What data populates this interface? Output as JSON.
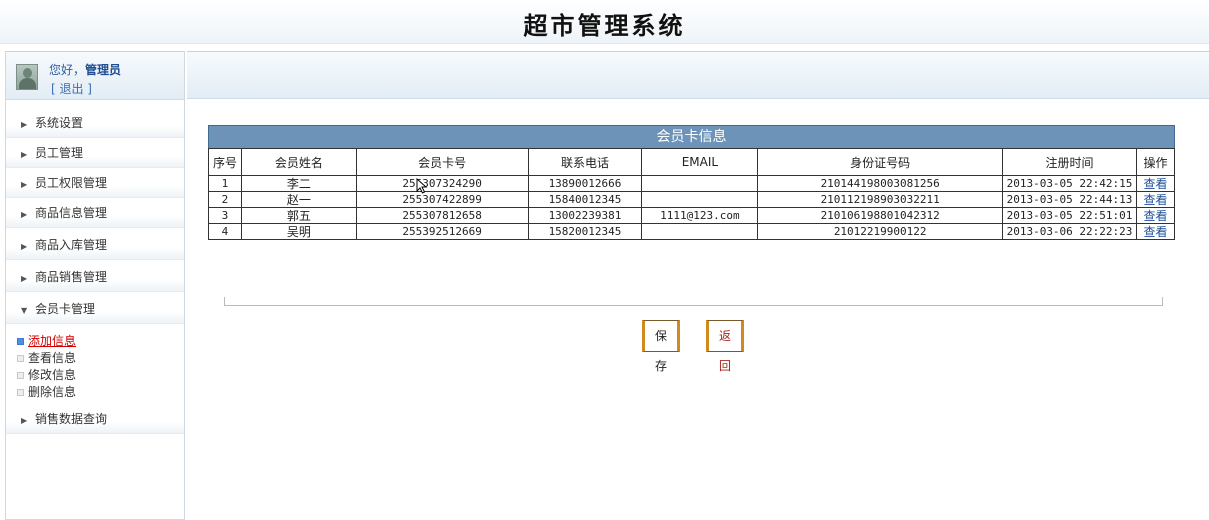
{
  "header": {
    "title": "超市管理系统"
  },
  "user": {
    "greeting_prefix": "您好，",
    "name": "管理员",
    "logout": "[ 退出 ]"
  },
  "sidebar": {
    "items": [
      {
        "label": "系统设置",
        "expanded": false
      },
      {
        "label": "员工管理",
        "expanded": false
      },
      {
        "label": "员工权限管理",
        "expanded": false
      },
      {
        "label": "商品信息管理",
        "expanded": false
      },
      {
        "label": "商品入库管理",
        "expanded": false
      },
      {
        "label": "商品销售管理",
        "expanded": false
      },
      {
        "label": "会员卡管理",
        "expanded": true
      },
      {
        "label": "销售数据查询",
        "expanded": false
      }
    ],
    "submenu": [
      {
        "label": "添加信息",
        "active": true
      },
      {
        "label": "查看信息",
        "active": false
      },
      {
        "label": "修改信息",
        "active": false
      },
      {
        "label": "删除信息",
        "active": false
      }
    ]
  },
  "table": {
    "caption": "会员卡信息",
    "headers": [
      "序号",
      "会员姓名",
      "会员卡号",
      "联系电话",
      "EMAIL",
      "身份证号码",
      "注册时间",
      "操作"
    ],
    "rows": [
      [
        "1",
        "李二",
        "255307324290",
        "13890012666",
        "",
        "210144198003081256",
        "2013-03-05 22:42:15",
        "查看"
      ],
      [
        "2",
        "赵一",
        "255307422899",
        "15840012345",
        "",
        "210112198903032211",
        "2013-03-05 22:44:13",
        "查看"
      ],
      [
        "3",
        "郭五",
        "255307812658",
        "13002239381",
        "1111@123.com",
        "210106198801042312",
        "2013-03-05 22:51:01",
        "查看"
      ],
      [
        "4",
        "吴明",
        "255392512669",
        "15820012345",
        "",
        "21012219900122",
        "2013-03-06 22:22:23",
        "查看"
      ]
    ]
  },
  "buttons": {
    "save": "保存",
    "back": "返回"
  },
  "colors": {
    "caption_bg": "#6d94b8",
    "link": "#1d4f9a",
    "active_menu": "#d40000",
    "button_border": "#d08a1e"
  }
}
